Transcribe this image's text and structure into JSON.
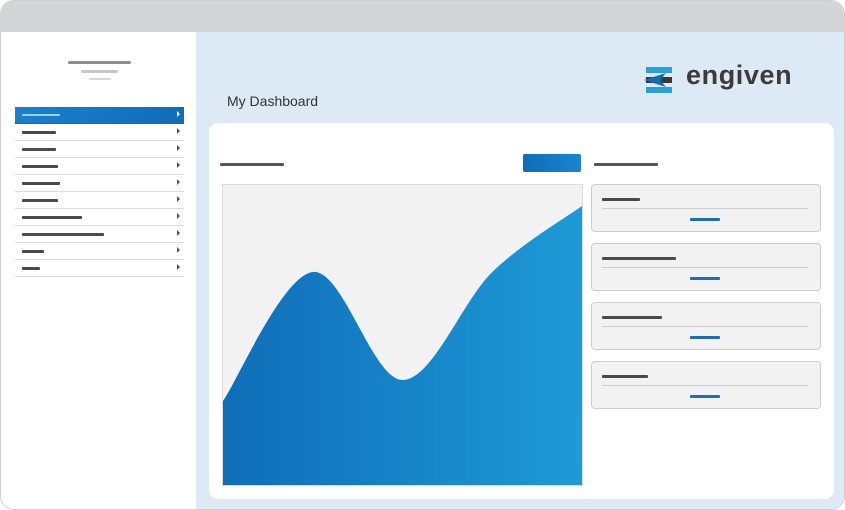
{
  "app": {
    "brand_name": "engiven",
    "accent_color": "#0f6db8",
    "accent_light": "#1e9ad6"
  },
  "header": {
    "title": "My Dashboard"
  },
  "sidebar": {
    "items": [
      {
        "active": true
      },
      {
        "active": false
      },
      {
        "active": false
      },
      {
        "active": false
      },
      {
        "active": false
      },
      {
        "active": false
      },
      {
        "active": false
      },
      {
        "active": false
      },
      {
        "active": false
      },
      {
        "active": false
      }
    ]
  },
  "chart_data": {
    "type": "area",
    "x": [
      0,
      1,
      2,
      3,
      4
    ],
    "values": [
      0.28,
      0.71,
      0.35,
      0.71,
      0.93
    ],
    "ylim": [
      0,
      1
    ],
    "gradient": [
      "#0f6db8",
      "#1e9ad6"
    ],
    "grid": false
  },
  "info_cards": [
    {
      "link_color": "#1a6fb8"
    },
    {
      "link_color": "#1a6fb8"
    },
    {
      "link_color": "#1a6fb8"
    },
    {
      "link_color": "#1a6fb8"
    }
  ]
}
